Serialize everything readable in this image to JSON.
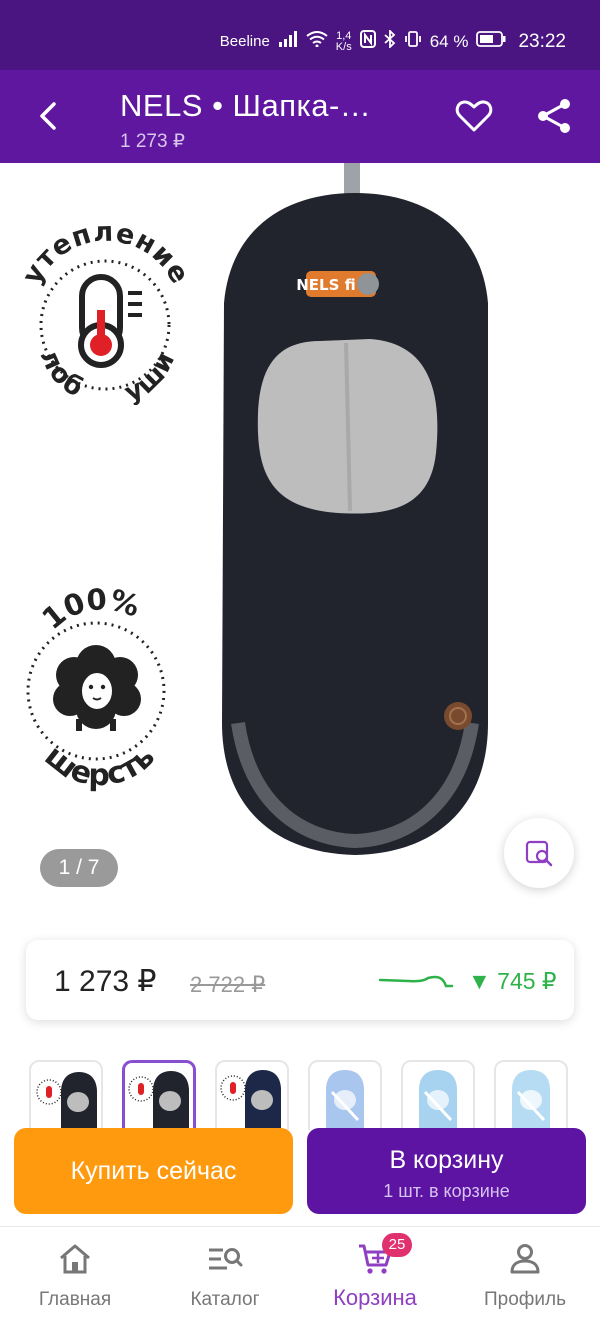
{
  "status_bar": {
    "carrier": "Beeline",
    "speed_value": "1,4",
    "speed_unit": "K/s",
    "battery": "64 %",
    "time": "23:22"
  },
  "app_bar": {
    "title": "NELS  •  Шапка-…",
    "price": "1 273 ₽"
  },
  "gallery": {
    "counter": "1 / 7",
    "badge_warm_top": "утепление",
    "badge_warm_bottom_left": "лоб",
    "badge_warm_bottom_right": "уши",
    "badge_wool_top": "100%",
    "badge_wool_bottom": "шерсть",
    "hat_logo": "NELS fi"
  },
  "price_card": {
    "current": "1 273 ₽",
    "old": "2 722 ₽",
    "drop": "▼ 745 ₽"
  },
  "actions": {
    "buy_now": "Купить сейчас",
    "to_cart": "В корзину",
    "in_cart": "1 шт. в корзине"
  },
  "bottom_nav": {
    "home": "Главная",
    "catalog": "Каталог",
    "cart": "Корзина",
    "cart_badge": "25",
    "profile": "Профиль"
  },
  "colors": {
    "status_bar": "#4a1580",
    "app_bar": "#5f17a0",
    "buy_now": "#ff9a0f",
    "to_cart": "#5e14a3",
    "price_drop": "#2fb24a",
    "nav_active": "#8e3fc2",
    "badge": "#e0306e"
  }
}
